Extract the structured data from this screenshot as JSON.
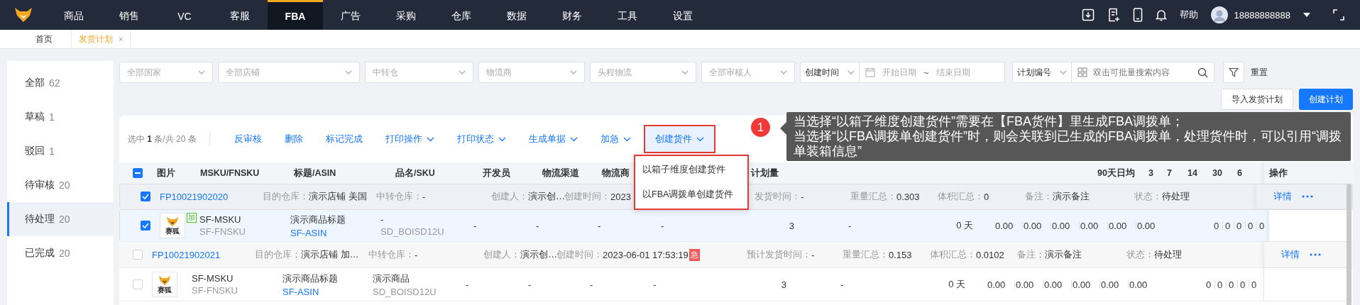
{
  "nav": {
    "items": [
      {
        "label": "商品",
        "selected": false
      },
      {
        "label": "销售",
        "selected": false
      },
      {
        "label": "VC",
        "selected": false
      },
      {
        "label": "客服",
        "selected": false
      },
      {
        "label": "FBA",
        "selected": true
      },
      {
        "label": "广告",
        "selected": false
      },
      {
        "label": "采购",
        "selected": false
      },
      {
        "label": "仓库",
        "selected": false
      },
      {
        "label": "数据",
        "selected": false
      },
      {
        "label": "财务",
        "selected": false
      },
      {
        "label": "工具",
        "selected": false
      },
      {
        "label": "设置",
        "selected": false
      }
    ],
    "help": "帮助",
    "user": "18888888888"
  },
  "tabs": [
    {
      "label": "首页",
      "selected": false
    },
    {
      "label": "发货计划",
      "selected": true,
      "close": "×"
    }
  ],
  "sidebar": {
    "items": [
      {
        "label": "全部",
        "count": "62",
        "selected": false
      },
      {
        "label": "草稿",
        "count": "1",
        "selected": false
      },
      {
        "label": "驳回",
        "count": "1",
        "selected": false
      },
      {
        "label": "待审核",
        "count": "20",
        "selected": false
      },
      {
        "label": "待处理",
        "count": "20",
        "selected": true
      },
      {
        "label": "已完成",
        "count": "20",
        "selected": false
      }
    ]
  },
  "filters": {
    "selects": [
      {
        "placeholder": "全部国家"
      },
      {
        "placeholder": "全部店铺"
      },
      {
        "placeholder": "中转仓"
      },
      {
        "placeholder": "物流商"
      },
      {
        "placeholder": "头程物流"
      },
      {
        "placeholder": "全部审核人"
      }
    ],
    "date": {
      "field": "创建时间",
      "start_placeholder": "开始日期",
      "separator": "~",
      "end_placeholder": "结束日期"
    },
    "search": {
      "field": "计划编号",
      "placeholder": "双击可批量搜索内容"
    },
    "reset": "重置"
  },
  "actions": {
    "import": "导入发货计划",
    "create": "创建计划"
  },
  "toolbar": {
    "selection": "选中 **1** 条/共 20 条",
    "buttons": [
      {
        "label": "反审核",
        "dropdown": false,
        "highlighted": false
      },
      {
        "label": "删除",
        "dropdown": false,
        "highlighted": false
      },
      {
        "label": "标记完成",
        "dropdown": false,
        "highlighted": false
      },
      {
        "label": "打印操作",
        "dropdown": true,
        "highlighted": false
      },
      {
        "label": "打印状态",
        "dropdown": true,
        "highlighted": false
      },
      {
        "label": "生成单据",
        "dropdown": true,
        "highlighted": false
      },
      {
        "label": "加急",
        "dropdown": true,
        "highlighted": false
      },
      {
        "label": "创建货件",
        "dropdown": true,
        "highlighted": true
      }
    ]
  },
  "menu": {
    "items": [
      "以箱子维度创建货件",
      "以FBA调拨单创建货件"
    ]
  },
  "callout": {
    "number": "1",
    "lines": [
      "当选择“以箱子维度创建货件”需要在【FBA货件】里生成FBA调拨单；",
      "当选择“以FBA调拨单创建货件”时，则会关联到已生成的FBA调拨单，处理货件时，可以引用“调拨单装箱信息”"
    ]
  },
  "table": {
    "select_all": {
      "indeterminate": true
    },
    "columns": [
      "图片",
      "MSKU/FNSKU",
      "标题/ASIN",
      "品名/SKU",
      "开发员",
      "物流渠道",
      "物流商",
      "计划量",
      "90天日均",
      "3",
      "7",
      "14",
      "30",
      "6",
      "操作"
    ],
    "plans": [
      {
        "selected": true,
        "id": "FP10021902020",
        "detail": "详情",
        "fields": [
          {
            "label": "目的仓库：",
            "value": "演示店铺  美国"
          },
          {
            "label": "中转仓库：",
            "value": "-"
          },
          {
            "label": "创建人：",
            "value": "演示创…"
          },
          {
            "label": "创建时间：",
            "value": "2023"
          },
          {
            "label": "发货时间：",
            "value": "-"
          },
          {
            "label": "重量汇总：",
            "value": "0.303"
          },
          {
            "label": "体积汇总：",
            "value": "0"
          },
          {
            "label": "备注：",
            "value": "演示备注"
          },
          {
            "label": "状态：",
            "value": "待处理"
          }
        ],
        "items": [
          {
            "selected": true,
            "image_caption": "赛狐",
            "tag": "加",
            "msku": "SF-MSKU",
            "fnsku": "SF-FNSKU",
            "title": "演示商品标题",
            "asin": "SF-ASIN",
            "name": "-",
            "sku": "SD_BOISD12U",
            "developer": "-",
            "channel": "-",
            "carrier": "-",
            "column_9": "-",
            "plan_qty": "3",
            "column_11": "-",
            "days": "0 天",
            "figures": [
              "0.00",
              "0.00",
              "0.00",
              "0.00",
              "0.00",
              "0.00"
            ],
            "counts": [
              "0",
              "0",
              "0",
              "0",
              "0"
            ]
          }
        ]
      },
      {
        "selected": false,
        "id": "FP10021902021",
        "detail": "详情",
        "fields": [
          {
            "label": "目的仓库：",
            "value": "演示店铺  加…"
          },
          {
            "label": "中转仓库：",
            "value": "-"
          },
          {
            "label": "创建人：",
            "value": "演示创…"
          },
          {
            "label": "创建时间：",
            "value": "2023-06-01 17:53:19",
            "badge": "急"
          },
          {
            "label": "预计发货时间：",
            "value": "-"
          },
          {
            "label": "重量汇总：",
            "value": "0.153"
          },
          {
            "label": "体积汇总：",
            "value": "0.0102"
          },
          {
            "label": "备注：",
            "value": "演示备注"
          },
          {
            "label": "状态：",
            "value": "待处理"
          }
        ],
        "items": [
          {
            "selected": false,
            "image_caption": "赛狐",
            "msku": "SF-MSKU",
            "fnsku": "SF-FNSKU",
            "title": "演示商品标题",
            "asin": "SF-ASIN",
            "name": "演示商品",
            "sku": "SD_BOISD12U",
            "developer": "-",
            "channel": "-",
            "carrier": "-",
            "column_9": "-",
            "plan_qty": "3",
            "column_11": "-",
            "days": "0 天",
            "figures": [
              "0.00",
              "0.00",
              "0.00",
              "0.00",
              "0.00",
              "0.00"
            ],
            "counts": [
              "0",
              "0",
              "0",
              "0",
              "0"
            ]
          }
        ]
      }
    ]
  }
}
